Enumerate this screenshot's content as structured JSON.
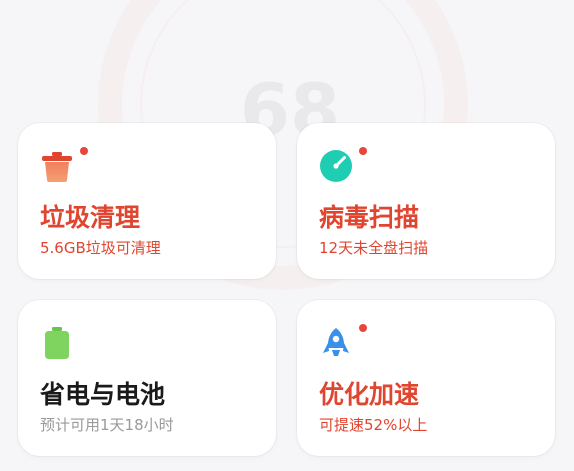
{
  "background": {
    "score_watermark": "68"
  },
  "colors": {
    "accent_red": "#e0452f",
    "alert_dot": "#e8453c",
    "title_dark": "#1a1a1a",
    "sub_gray": "#9a9a9a",
    "teal": "#1fcdb2",
    "green": "#7fd45f",
    "blue": "#3a8fe8"
  },
  "cards": [
    {
      "id": "junk",
      "icon": "trash-can-icon",
      "has_alert_dot": true,
      "title": "垃圾清理",
      "subtitle": "5.6GB垃圾可清理"
    },
    {
      "id": "virus",
      "icon": "virus-scan-icon",
      "has_alert_dot": true,
      "title": "病毒扫描",
      "subtitle": "12天未全盘扫描"
    },
    {
      "id": "battery",
      "icon": "battery-icon",
      "has_alert_dot": false,
      "title": "省电与电池",
      "subtitle": "预计可用1天18小时"
    },
    {
      "id": "boost",
      "icon": "rocket-icon",
      "has_alert_dot": true,
      "title": "优化加速",
      "subtitle": "可提速52%以上"
    }
  ]
}
